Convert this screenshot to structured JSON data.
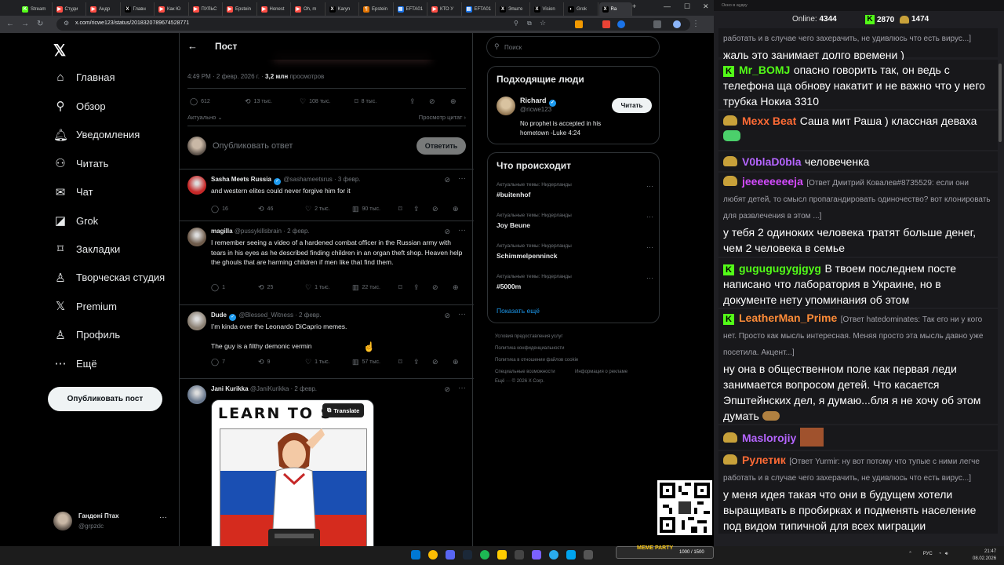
{
  "browser": {
    "tabs": [
      {
        "label": "Stream",
        "color": "#53fc18",
        "glyph": "K"
      },
      {
        "label": "Студи",
        "color": "#ff4e45",
        "glyph": "▶"
      },
      {
        "label": "Андр",
        "color": "#ff4e45",
        "glyph": "▶"
      },
      {
        "label": "Главн",
        "color": "#000000",
        "glyph": "X"
      },
      {
        "label": "Как Ю",
        "color": "#ff4e45",
        "glyph": "▶"
      },
      {
        "label": "ПУЛЬС",
        "color": "#ff4e45",
        "glyph": "▶"
      },
      {
        "label": "Epstein",
        "color": "#ff4e45",
        "glyph": "▶"
      },
      {
        "label": "Honest",
        "color": "#ff4e45",
        "glyph": "▶"
      },
      {
        "label": "Oh, m",
        "color": "#ff4e45",
        "glyph": "▶"
      },
      {
        "label": "Karyn",
        "color": "#000000",
        "glyph": "X"
      },
      {
        "label": "Epstein",
        "color": "#e37400",
        "glyph": "¶"
      },
      {
        "label": "EFTA01",
        "color": "#1a73e8",
        "glyph": "▤"
      },
      {
        "label": "КТО У",
        "color": "#ff4e45",
        "glyph": "▶"
      },
      {
        "label": "EFTA01",
        "color": "#1a73e8",
        "glyph": "▤"
      },
      {
        "label": "Эпште",
        "color": "#000000",
        "glyph": "X"
      },
      {
        "label": "Vision",
        "color": "#000000",
        "glyph": "X"
      },
      {
        "label": "Grok",
        "color": "#000000",
        "glyph": "◐"
      },
      {
        "label": "Ra",
        "color": "#000000",
        "glyph": "X"
      }
    ],
    "url": "x.com/ricwe123/status/2018320789674528771"
  },
  "twitter": {
    "nav": [
      {
        "label": "Главная",
        "icon": "home-icon",
        "glyph": "⌂"
      },
      {
        "label": "Обзор",
        "icon": "search-icon",
        "glyph": "⚲"
      },
      {
        "label": "Уведомления",
        "icon": "bell-icon",
        "glyph": "🔔︎"
      },
      {
        "label": "Читать",
        "icon": "follow-icon",
        "glyph": "⚇"
      },
      {
        "label": "Чат",
        "icon": "mail-icon",
        "glyph": "✉"
      },
      {
        "label": "Grok",
        "icon": "grok-icon",
        "glyph": "◪"
      },
      {
        "label": "Закладки",
        "icon": "bookmark-icon",
        "glyph": "⌑"
      },
      {
        "label": "Творческая студия",
        "icon": "studio-icon",
        "glyph": "♙"
      },
      {
        "label": "Premium",
        "icon": "x-premium-icon",
        "glyph": "𝕏"
      },
      {
        "label": "Профиль",
        "icon": "profile-icon",
        "glyph": "♙"
      },
      {
        "label": "Ещё",
        "icon": "more-icon",
        "glyph": "⋯"
      }
    ],
    "post_button": "Опубликовать пост",
    "profile": {
      "name": "Гандоні Птах",
      "handle": "@grpzdc"
    },
    "header_title": "Пост",
    "meta_time": "4:49 PM · 2 февр. 2026 г. · ",
    "meta_views": "3,2 млн",
    "meta_views_label": " просмотров",
    "main_stats": {
      "replies": "612",
      "reposts": "13 тыс.",
      "likes": "108 тыс.",
      "bookmarks": "8 тыс."
    },
    "sort_label": "Актуально",
    "quotes_label": "Просмотр цитат ›",
    "reply_placeholder": "Опубликовать ответ",
    "reply_button": "Ответить",
    "replies": [
      {
        "name": "Sasha Meets Russia",
        "verified": true,
        "handle": "@sashameetsrus · 3 февр.",
        "text": "and western elites could never forgive him for it",
        "stats": {
          "r": "16",
          "rt": "46",
          "l": "2 тыс.",
          "v": "90 тыс."
        },
        "avatar": "#c62828"
      },
      {
        "name": "magilla",
        "verified": false,
        "handle": "@pussykillsbrain · 2 февр.",
        "text": "I remember seeing a video of a hardened combat officer in the Russian army with tears in his eyes as he described finding children in an organ theft shop. Heaven help the ghouls that are harming children if men like that find them.",
        "stats": {
          "r": "1",
          "rt": "25",
          "l": "1 тыс.",
          "v": "22 тыс."
        },
        "avatar": "#6d5a4a"
      },
      {
        "name": "Dude",
        "verified": true,
        "handle": "@Blessed_Witness · 2 февр.",
        "text": "I’m kinda over the Leonardo DiCaprio memes.\n\nThe guy is a filthy demonic vermin",
        "stats": {
          "r": "7",
          "rt": "9",
          "l": "1 тыс.",
          "v": "57 тыс."
        },
        "avatar": "#8a7f72"
      },
      {
        "name": "Jani Kurikka",
        "verified": false,
        "handle": "@JaniKurikka · 2 февр.",
        "image_text": "LEARN TO S",
        "translate_label": "Translate",
        "avatar": "#6b7a8f"
      }
    ],
    "search_placeholder": "Поиск",
    "who_to_follow": {
      "title": "Подходящие люди",
      "name": "Richard",
      "handle": "@ricwe123",
      "bio": "No prophet is accepted in his hometown -Luke 4:24",
      "follow_label": "Читать"
    },
    "trends": {
      "title": "Что происходит",
      "items": [
        {
          "context": "Актуальные темы: Нидерланды",
          "topic": "#buitenhof"
        },
        {
          "context": "Актуальные темы: Нидерланды",
          "topic": "Joy Beune"
        },
        {
          "context": "Актуальные темы: Нидерланды",
          "topic": "Schimmelpenninck"
        },
        {
          "context": "Актуальные темы: Нидерланды",
          "topic": "#5000m"
        }
      ],
      "show_more": "Показать ещё"
    },
    "footer": {
      "l1": "Условия предоставления услуг",
      "l2": "Политика конфиденциальности",
      "l3": "Политика в отношении файлов cookie",
      "l4a": "Специальные возможности",
      "l4b": "Информация о рекламе",
      "l5": "Ещё ···     © 2026 X Corp."
    }
  },
  "chat": {
    "window_title": "Окно в аудку",
    "online_label": "Online: ",
    "online_count": "4344",
    "count_kick": "2870",
    "count_other": "1474",
    "messages": [
      {
        "user": "",
        "reply": "работать и в случае чего захерачить, не удивлюсь что есть вирус...]",
        "text": "жаль это занимает долго времени )",
        "color": "#ffffff",
        "badge": "none"
      },
      {
        "user": "Mr_BOMJ",
        "reply": "",
        "text": "опасно говорить так, он ведь с телефона ща обнову накатит и не важно что у него трубка Нокиа 3310",
        "color": "#53fc18",
        "badge": "kick"
      },
      {
        "user": "Mexx Beat",
        "reply": "",
        "text": "Саша мит Раша ) классная деваха",
        "color": "#ff6b35",
        "badge": "emote"
      },
      {
        "user": "V0blaD0bla",
        "reply": "",
        "text": "человеченка",
        "color": "#b565ff",
        "badge": "emote"
      },
      {
        "user": "jeeeeeeeeja",
        "reply": "[Ответ Дмитрий Ковалев#8735529: если они любят детей, то смысл пропагандировать одиночество? вот клонировать для развлечения в этом ...]",
        "text": "у тебя 2 одиноких человека тратят больше денег, чем 2 человека в семье",
        "color": "#d34bff",
        "badge": "emote"
      },
      {
        "user": "gugugugygjgyg",
        "reply": "",
        "text": "В твоем последнем посте написано что лаборатория в Украине, но в документе нету упоминания об этом",
        "color": "#53fc18",
        "badge": "kick"
      },
      {
        "user": "LeatherMan_Prime",
        "reply": "[Ответ hatedominates: Так его ни у кого нет. Просто как мысль интересная. Меняя просто эта мысль давно уже посетила. Акцент...]",
        "text": "ну она в общественном поле как первая леди занимается вопросом детей. Что касается Эпштейнских дел, я думаю...бля я не хочу об этом думать",
        "color": "#ff8c38",
        "badge": "kick"
      },
      {
        "user": "Maslorojiy",
        "reply": "",
        "text": "",
        "color": "#b565ff",
        "badge": "emote"
      },
      {
        "user": "Рулетик",
        "reply": "[Ответ Yurmir: ну вот потому что тупые с ними легче работать и в случае чего захерачить, не удивлюсь что есть вирус...]",
        "text": "у меня идея такая что они в будущем хотели выращивать в пробирках и подменять население под видом типичной для всех миграции",
        "color": "#ff6b35",
        "badge": "emote"
      }
    ]
  },
  "overlay": {
    "meme_party": "MEME PARTY",
    "meme_progress": "1000 / 1500"
  },
  "taskbar": {
    "lang": "РУС",
    "time": "21:47",
    "date": "08.02.2026"
  }
}
